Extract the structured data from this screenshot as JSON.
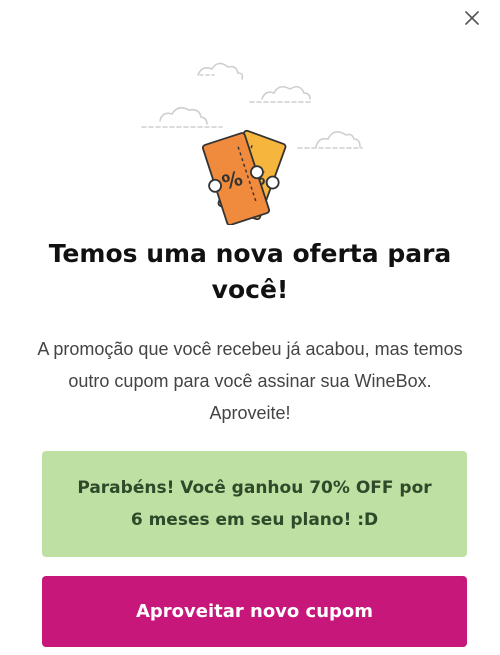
{
  "modal": {
    "close_icon": "close-icon",
    "illustration_icon": "discount-tickets-icon",
    "title": "Temos uma nova oferta para você!",
    "message": "A promoção que você recebeu já acabou, mas temos outro cupom para você assinar sua WineBox. Aproveite!",
    "notice": "Parabéns! Você ganhou 70% OFF por 6 meses em seu plano! :D",
    "cta_label": "Aproveitar novo cupom"
  },
  "colors": {
    "cta_background": "#c8177a",
    "notice_background": "#bfe0a3",
    "ticket_orange": "#f08a3c",
    "ticket_yellow": "#f6b53d"
  }
}
